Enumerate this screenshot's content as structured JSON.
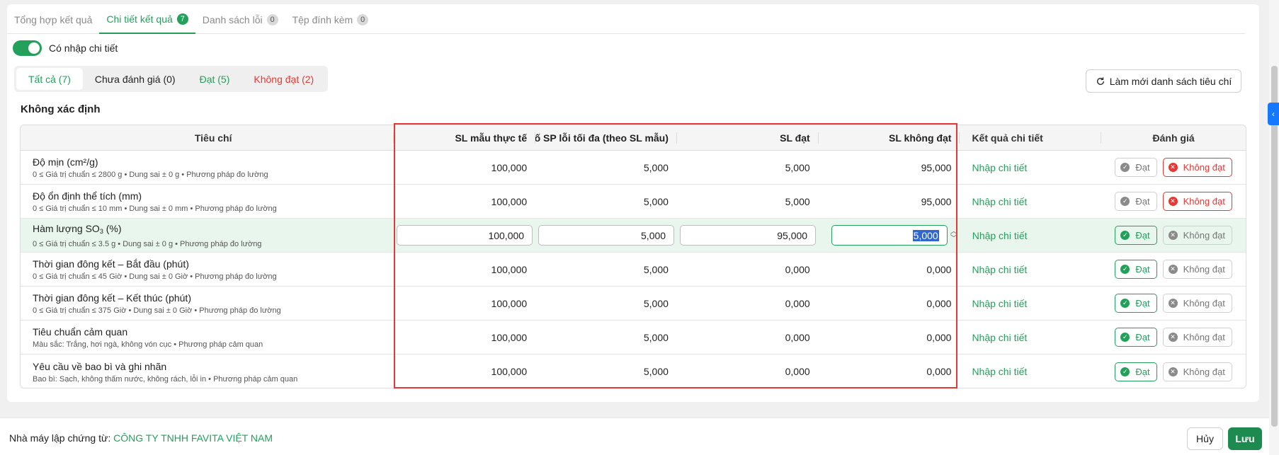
{
  "tabs": [
    {
      "label": "Tổng hợp kết quả",
      "count": ""
    },
    {
      "label": "Chi tiết kết quả",
      "count": "7"
    },
    {
      "label": "Danh sách lỗi",
      "count": "0"
    },
    {
      "label": "Tệp đính kèm",
      "count": "0"
    }
  ],
  "toggle": {
    "label": "Có nhập chi tiết",
    "on": true
  },
  "filters": [
    {
      "label": "Tất cả (7)"
    },
    {
      "label": "Chưa đánh giá (0)"
    },
    {
      "label": "Đạt (5)"
    },
    {
      "label": "Không đạt (2)"
    }
  ],
  "refresh_label": "Làm mới danh sách tiêu chí",
  "section_title": "Không xác định",
  "table": {
    "headers": {
      "criteria": "Tiêu chí",
      "sample_qty": "SL mẫu thực tế",
      "max_defect": "Số SP lỗi tối đa (theo SL mẫu)",
      "pass_qty": "SL đạt",
      "fail_qty": "SL không đạt",
      "detail_result": "Kết quả chi tiết",
      "evaluation": "Đánh giá"
    },
    "rows": [
      {
        "name": "Độ mịn (cm²/g)",
        "desc": "0 ≤ Giá trị chuẩn ≤ 2800 g • Dung sai ± 0 g • Phương pháp đo lường",
        "sample": "100,000",
        "max_defect": "5,000",
        "pass": "5,000",
        "fail": "95,000",
        "detail": "Nhập chi tiết",
        "pass_label": "Đạt",
        "fail_label": "Không đạt",
        "result": "fail"
      },
      {
        "name": "Độ ổn định thể tích (mm)",
        "desc": "0 ≤ Giá trị chuẩn ≤ 10 mm • Dung sai ± 0 mm • Phương pháp đo lường",
        "sample": "100,000",
        "max_defect": "5,000",
        "pass": "5,000",
        "fail": "95,000",
        "detail": "Nhập chi tiết",
        "pass_label": "Đạt",
        "fail_label": "Không đạt",
        "result": "fail"
      },
      {
        "name_prefix": "Hàm lượng SO",
        "name_sub": "3",
        "name_suffix": " (%)",
        "desc": "0 ≤ Giá trị chuẩn ≤ 3.5 g • Dung sai ± 0 g • Phương pháp đo lường",
        "sample": "100,000",
        "max_defect": "5,000",
        "pass": "95,000",
        "fail": "5,000",
        "detail": "Nhập chi tiết",
        "pass_label": "Đạt",
        "fail_label": "Không đạt",
        "result": "pass",
        "editing": true
      },
      {
        "name": "Thời gian đông kết – Bắt đầu (phút)",
        "desc": "0 ≤ Giá trị chuẩn ≤ 45 Giờ • Dung sai ± 0 Giờ • Phương pháp đo lường",
        "sample": "100,000",
        "max_defect": "5,000",
        "pass": "0,000",
        "fail": "0,000",
        "detail": "Nhập chi tiết",
        "pass_label": "Đạt",
        "fail_label": "Không đạt",
        "result": "pass"
      },
      {
        "name": "Thời gian đông kết – Kết thúc (phút)",
        "desc": "0 ≤ Giá trị chuẩn ≤ 375 Giờ • Dung sai ± 0 Giờ • Phương pháp đo lường",
        "sample": "100,000",
        "max_defect": "5,000",
        "pass": "0,000",
        "fail": "0,000",
        "detail": "Nhập chi tiết",
        "pass_label": "Đạt",
        "fail_label": "Không đạt",
        "result": "pass"
      },
      {
        "name": "Tiêu chuẩn cảm quan",
        "desc": "Màu sắc: Trắng, hơi ngà, không vón cục • Phương pháp cảm quan",
        "sample": "100,000",
        "max_defect": "5,000",
        "pass": "0,000",
        "fail": "0,000",
        "detail": "Nhập chi tiết",
        "pass_label": "Đạt",
        "fail_label": "Không đạt",
        "result": "pass"
      },
      {
        "name": "Yêu cầu về bao bì và ghi nhãn",
        "desc": "Bao bì: Sạch, không thấm nước, không rách, lỗi in • Phương pháp cảm quan",
        "sample": "100,000",
        "max_defect": "5,000",
        "pass": "0,000",
        "fail": "0,000",
        "detail": "Nhập chi tiết",
        "pass_label": "Đạt",
        "fail_label": "Không đạt",
        "result": "pass"
      }
    ]
  },
  "footer": {
    "label": "Nhà máy lập chứng từ:",
    "company": "CÔNG TY TNHH FAVITA VIỆT NAM",
    "cancel_label": "Hủy",
    "save_label": "Lưu"
  },
  "colors": {
    "accent": "#23a05a",
    "danger": "#e53935",
    "side_tab": "#1677ff"
  },
  "icons": {
    "refresh": "refresh-icon",
    "collapse": "chevron-left-icon",
    "check": "check-circle-icon",
    "close": "close-circle-icon"
  }
}
